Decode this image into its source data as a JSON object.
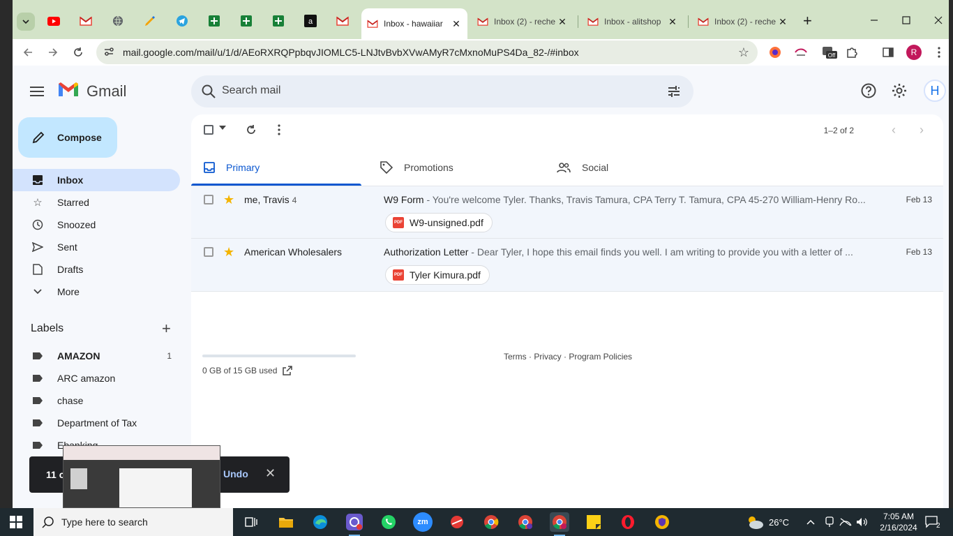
{
  "tabs": {
    "active": {
      "title": "Inbox - hawaiiar"
    },
    "others": [
      {
        "title": "Inbox (2) - reche"
      },
      {
        "title": "Inbox - alitshop"
      },
      {
        "title": "Inbox (2) - reche"
      }
    ]
  },
  "toolbar": {
    "url": "mail.google.com/mail/u/1/d/AEoRXRQPpbqvJIOMLC5-LNJtvBvbXVwAMyR7cMxnoMuPS4Da_82-/#inbox",
    "profile_letter": "R",
    "ext_off_label": "Off"
  },
  "gmail": {
    "brand": "Gmail",
    "search_placeholder": "Search mail",
    "avatar_letter": "H",
    "compose_label": "Compose",
    "nav": [
      {
        "label": "Inbox"
      },
      {
        "label": "Starred"
      },
      {
        "label": "Snoozed"
      },
      {
        "label": "Sent"
      },
      {
        "label": "Drafts"
      },
      {
        "label": "More"
      }
    ],
    "labels_heading": "Labels",
    "labels": [
      {
        "label": "AMAZON",
        "count": "1"
      },
      {
        "label": "ARC amazon"
      },
      {
        "label": "chase"
      },
      {
        "label": "Department of Tax"
      },
      {
        "label": "Ebanking"
      }
    ],
    "pager": "1–2 of 2",
    "categories": [
      {
        "label": "Primary"
      },
      {
        "label": "Promotions"
      },
      {
        "label": "Social"
      }
    ],
    "emails": [
      {
        "sender": "me, Travis",
        "count": "4",
        "subject": "W9 Form",
        "snippet": " - You're welcome Tyler. Thanks, Travis Tamura, CPA Terry T. Tamura, CPA 45-270 William-Henry Ro...",
        "date": "Feb 13",
        "attachment": "W9-unsigned.pdf",
        "starred": true
      },
      {
        "sender": "American Wholesalers",
        "subject": "Authorization Letter",
        "snippet": " - Dear Tyler, I hope this email finds you well. I am writing to provide you with a letter of ...",
        "date": "Feb 13",
        "attachment": "Tyler Kimura.pdf",
        "starred": true
      }
    ],
    "storage_text": "0 GB of 15 GB used",
    "footer_links": "Terms · Privacy · Program Policies"
  },
  "snackbar": {
    "text": "11 co",
    "undo": "Undo"
  },
  "taskbar": {
    "search_placeholder": "Type here to search",
    "weather": "26°C",
    "time": "7:05 AM",
    "date": "2/16/2024",
    "notif_count": "2",
    "zoom_label": "zm"
  }
}
